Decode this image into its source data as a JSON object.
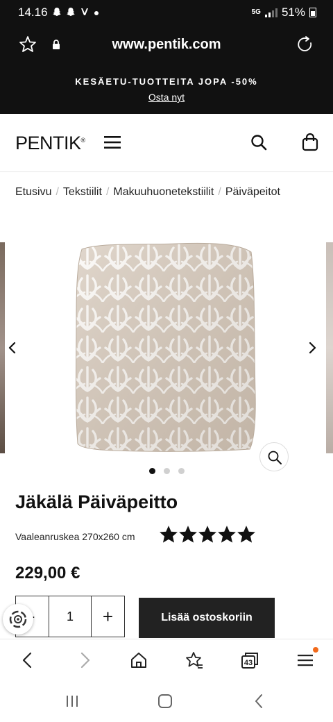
{
  "status_bar": {
    "time": "14.16",
    "notification_icons": [
      "snapchat-icon",
      "snapchat-icon",
      "vivino-icon",
      "dot-icon"
    ],
    "network": "5G",
    "battery": "51%"
  },
  "browser": {
    "url": "www.pentik.com",
    "tabs_count": "43"
  },
  "promo": {
    "text": "KESÄETU-TUOTTEITA JOPA -50%",
    "link": "Osta nyt"
  },
  "header": {
    "logo": "PENTIK",
    "logo_mark": "®"
  },
  "breadcrumb": [
    "Etusivu",
    "Tekstiilit",
    "Makuuhuonetekstiilit",
    "Päiväpeitot"
  ],
  "gallery": {
    "image_count": 3,
    "active_index": 0
  },
  "product": {
    "title": "Jäkälä Päiväpeitto",
    "variant": "Vaaleanruskea 270x260 cm",
    "rating_stars": 5,
    "rating_max": 5,
    "price": "229,00 €",
    "quantity": "1",
    "minus_label": "-",
    "plus_label": "+",
    "add_to_cart_label": "Lisää ostoskoriin"
  },
  "colors": {
    "dark": "#111111",
    "button": "#222222",
    "notification_dot": "#f26a1b",
    "fabric_base": "#d8cbbd"
  }
}
